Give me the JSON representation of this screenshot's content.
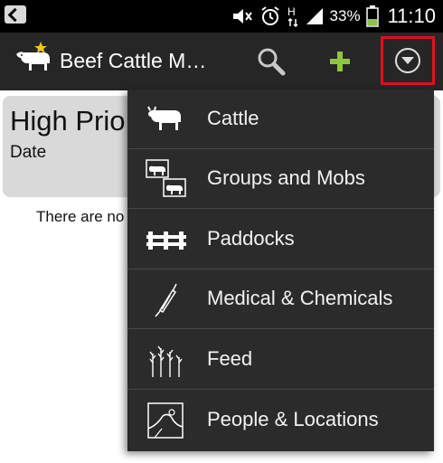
{
  "status_bar": {
    "battery_percent": "33%",
    "time": "11:10"
  },
  "action_bar": {
    "title": "Beef Cattle M…",
    "icons": {
      "logo": "cow-star-logo-icon",
      "search": "search-icon",
      "add": "add-icon",
      "overflow": "dropdown-arrow-icon"
    }
  },
  "content": {
    "card_title": "High Prio",
    "card_date": "Date",
    "empty_text": "There are no"
  },
  "menu": {
    "items": [
      {
        "label": "Cattle",
        "icon": "cattle-icon"
      },
      {
        "label": "Groups and Mobs",
        "icon": "groups-icon"
      },
      {
        "label": "Paddocks",
        "icon": "fence-icon"
      },
      {
        "label": "Medical & Chemicals",
        "icon": "syringe-icon"
      },
      {
        "label": "Feed",
        "icon": "feed-icon"
      },
      {
        "label": "People & Locations",
        "icon": "map-icon"
      }
    ]
  },
  "colors": {
    "action_bar": "#262626",
    "menu_bg": "#2b2b2b",
    "add_green": "#8cc63f",
    "highlight_red": "#e0101c",
    "card_bg": "#d9d9d9"
  }
}
